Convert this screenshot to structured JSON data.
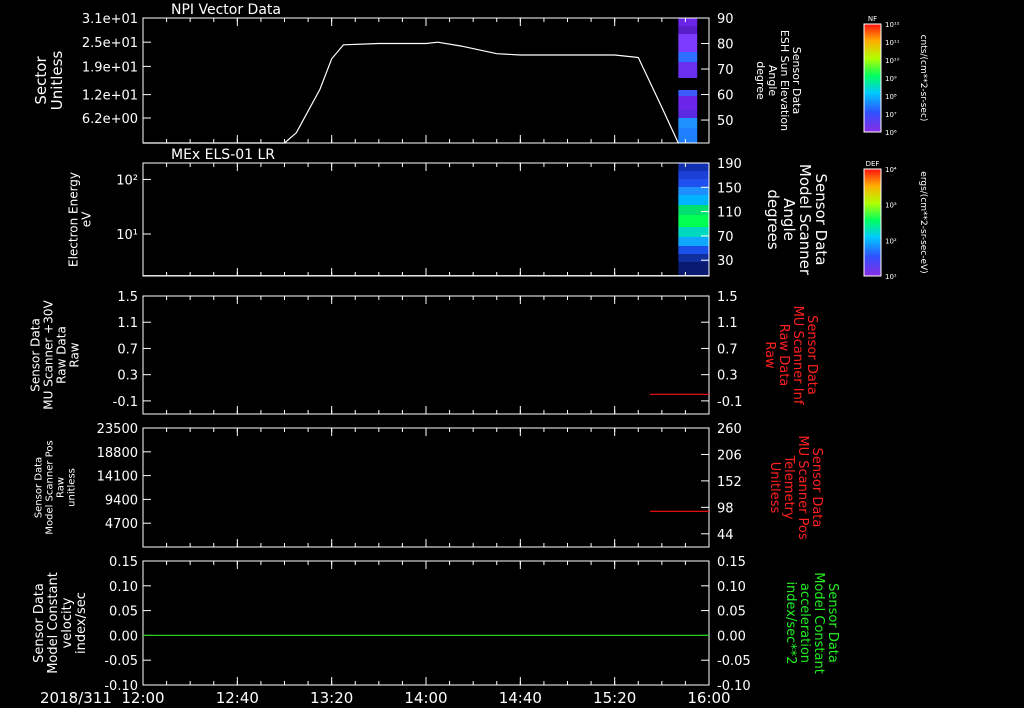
{
  "date_label": "2018/311",
  "time_ticks": [
    "12:00",
    "12:40",
    "13:20",
    "14:00",
    "14:40",
    "15:20",
    "16:00"
  ],
  "colors": {
    "background": "#000000",
    "foreground": "#ffffff",
    "red_trace": "#ff1010",
    "green_trace": "#22cc22",
    "red_label": "#ff2020",
    "green_label": "#22ee22"
  },
  "colorbars": [
    {
      "title": "NF",
      "units": "cnts/(cm**2-sr-sec)",
      "ticks": [
        "10¹²",
        "10¹¹",
        "10¹⁰",
        "10⁹",
        "10⁸",
        "10⁷",
        "10⁶"
      ]
    },
    {
      "title": "DEF",
      "units": "ergs/(cm**2-sr-sec-eV)",
      "ticks": [
        "10⁴",
        "10³",
        "10²",
        "10¹"
      ]
    }
  ],
  "chart_data": [
    {
      "type": "line",
      "title": "NPI Vector Data",
      "left_axis": {
        "label_lines": [
          "Sector",
          "Unitless"
        ],
        "ticks": [
          "3.1e+01",
          "2.5e+01",
          "1.9e+01",
          "1.2e+01",
          "6.2e+00"
        ],
        "tick_values": [
          31,
          25,
          19,
          12,
          6.2
        ],
        "range": [
          0,
          31
        ]
      },
      "right_axis": {
        "label_lines": [
          "Sensor Data",
          "ESH Sun Elevation",
          "Angle",
          "degree"
        ],
        "ticks": [
          "90",
          "80",
          "70",
          "60",
          "50"
        ],
        "tick_values": [
          90,
          80,
          70,
          60,
          50
        ],
        "range": [
          41,
          90
        ]
      },
      "series": [
        {
          "axis": "right",
          "color": "#ffffff",
          "x": [
            "12:00",
            "13:00",
            "13:05",
            "13:15",
            "13:20",
            "13:25",
            "13:40",
            "14:00",
            "14:05",
            "14:15",
            "14:30",
            "14:40",
            "15:00",
            "15:20",
            "15:30",
            "15:40",
            "15:47"
          ],
          "y": [
            41,
            41,
            45,
            62,
            74,
            79.5,
            80,
            80,
            80.5,
            79,
            76,
            75.5,
            75.5,
            75.5,
            74.5,
            55,
            41
          ]
        }
      ],
      "spectrogram": {
        "x_start": "15:47",
        "x_end": "15:55",
        "description_colors": [
          "#6a25e8",
          "#7b3cff",
          "#3a5cff",
          "#1e90ff",
          "#0000c8",
          "#000000"
        ]
      }
    },
    {
      "type": "heatmap",
      "title": "MEx ELS-01 LR",
      "left_axis": {
        "label_lines": [
          "Electron Energy",
          "eV"
        ],
        "ticks": [
          "10²",
          "10¹"
        ],
        "scale": "log",
        "range": [
          1.7,
          200
        ]
      },
      "right_axis": {
        "label_lines": [
          "Sensor Data",
          "Model Scanner",
          "Angle",
          "degrees"
        ],
        "ticks": [
          "190",
          "150",
          "110",
          "70",
          "30"
        ],
        "tick_values": [
          190,
          150,
          110,
          70,
          30
        ],
        "range": [
          4,
          190
        ]
      },
      "series": [
        {
          "axis": "right",
          "color": "#ffffff",
          "x": [
            "12:00",
            "16:00"
          ],
          "y": [
            4.5,
            4.5
          ]
        }
      ],
      "spectrogram": {
        "x_start": "15:47",
        "x_end": "16:00"
      }
    },
    {
      "type": "line",
      "left_axis": {
        "label_lines": [
          "Sensor Data",
          "MU Scanner +30V",
          "Raw Data",
          "Raw"
        ],
        "ticks": [
          "1.5",
          "1.1",
          "0.7",
          "0.3",
          "-0.1"
        ],
        "tick_values": [
          1.5,
          1.1,
          0.7,
          0.3,
          -0.1
        ],
        "range": [
          -0.3,
          1.5
        ]
      },
      "right_axis": {
        "label_lines": [
          "Sensor Data",
          "MU Scanner Inf",
          "Raw Data",
          "Raw"
        ],
        "ticks": [
          "1.5",
          "1.1",
          "0.7",
          "0.3",
          "-0.1"
        ],
        "tick_values": [
          1.5,
          1.1,
          0.7,
          0.3,
          -0.1
        ],
        "range": [
          -0.3,
          1.5
        ]
      },
      "series": [
        {
          "axis": "right",
          "color": "#ff1010",
          "x": [
            "15:35",
            "16:00"
          ],
          "y": [
            0.0,
            0.0
          ]
        }
      ]
    },
    {
      "type": "line",
      "left_axis": {
        "label_lines": [
          "Sensor Data",
          "Model Scanner Pos",
          "Raw",
          "unitless"
        ],
        "ticks": [
          "23500",
          "18800",
          "14100",
          "9400",
          "4700"
        ],
        "tick_values": [
          23500,
          18800,
          14100,
          9400,
          4700
        ],
        "range": [
          0,
          23500
        ]
      },
      "right_axis": {
        "label_lines": [
          "Sensor Data",
          "MU Scanner Pos",
          "Telemetry",
          "Unitless"
        ],
        "ticks": [
          "260",
          "206",
          "152",
          "98",
          "44"
        ],
        "tick_values": [
          260,
          206,
          152,
          98,
          44
        ],
        "range": [
          17,
          260
        ]
      },
      "series": [
        {
          "axis": "right",
          "color": "#ff1010",
          "x": [
            "15:35",
            "16:00"
          ],
          "y": [
            90,
            90
          ]
        }
      ]
    },
    {
      "type": "line",
      "left_axis": {
        "label_lines": [
          "Sensor Data",
          "Model Constant",
          "velocity",
          "index/sec"
        ],
        "ticks": [
          "0.15",
          "0.10",
          "0.05",
          "0.00",
          "-0.05",
          "-0.10"
        ],
        "tick_values": [
          0.15,
          0.1,
          0.05,
          0.0,
          -0.05,
          -0.1
        ],
        "range": [
          -0.1,
          0.15
        ]
      },
      "right_axis": {
        "label_lines": [
          "Sensor Data",
          "Model Constant",
          "acceleration",
          "index/sec**2"
        ],
        "ticks": [
          "0.15",
          "0.10",
          "0.05",
          "0.00",
          "-0.05",
          "-0.10"
        ],
        "tick_values": [
          0.15,
          0.1,
          0.05,
          0.0,
          -0.05,
          -0.1
        ],
        "range": [
          -0.1,
          0.15
        ]
      },
      "series": [
        {
          "axis": "left",
          "color": "#22cc22",
          "x": [
            "12:00",
            "16:00"
          ],
          "y": [
            0.0,
            0.0
          ]
        }
      ]
    }
  ]
}
